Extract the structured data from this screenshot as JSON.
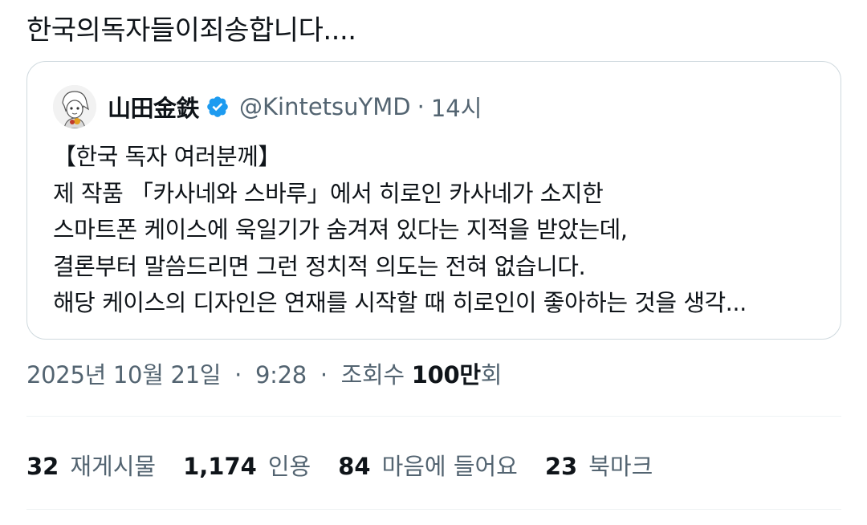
{
  "post": {
    "text": "한국의독자들이죄송합니다...."
  },
  "quoted": {
    "display_name": "山田金鉄",
    "handle": "@KintetsuYMD",
    "separator": "·",
    "time": "14시",
    "lines": [
      "【한국 독자 여러분께】",
      "제 작품 「카사네와 스바루」에서 히로인 카사네가 소지한",
      "스마트폰 케이스에 욱일기가 숨겨져 있다는 지적을 받았는데,",
      "결론부터 말씀드리면 그런 정치적 의도는 전혀 없습니다.",
      "해당 케이스의 디자인은 연재를 시작할 때 히로인이 좋아하는 것을 생각..."
    ],
    "verified_color": "#1d9bf0"
  },
  "meta": {
    "date": "2025년 10월 21일",
    "dot1": "·",
    "time": "9:28",
    "dot2": "·",
    "views_label": "조회수",
    "views_num": "100만",
    "views_unit": "회"
  },
  "stats": {
    "reposts_num": "32",
    "reposts_label": "재게시물",
    "quotes_num": "1,174",
    "quotes_label": "인용",
    "likes_num": "84",
    "likes_label": "마음에 들어요",
    "bookmarks_num": "23",
    "bookmarks_label": "북마크"
  }
}
